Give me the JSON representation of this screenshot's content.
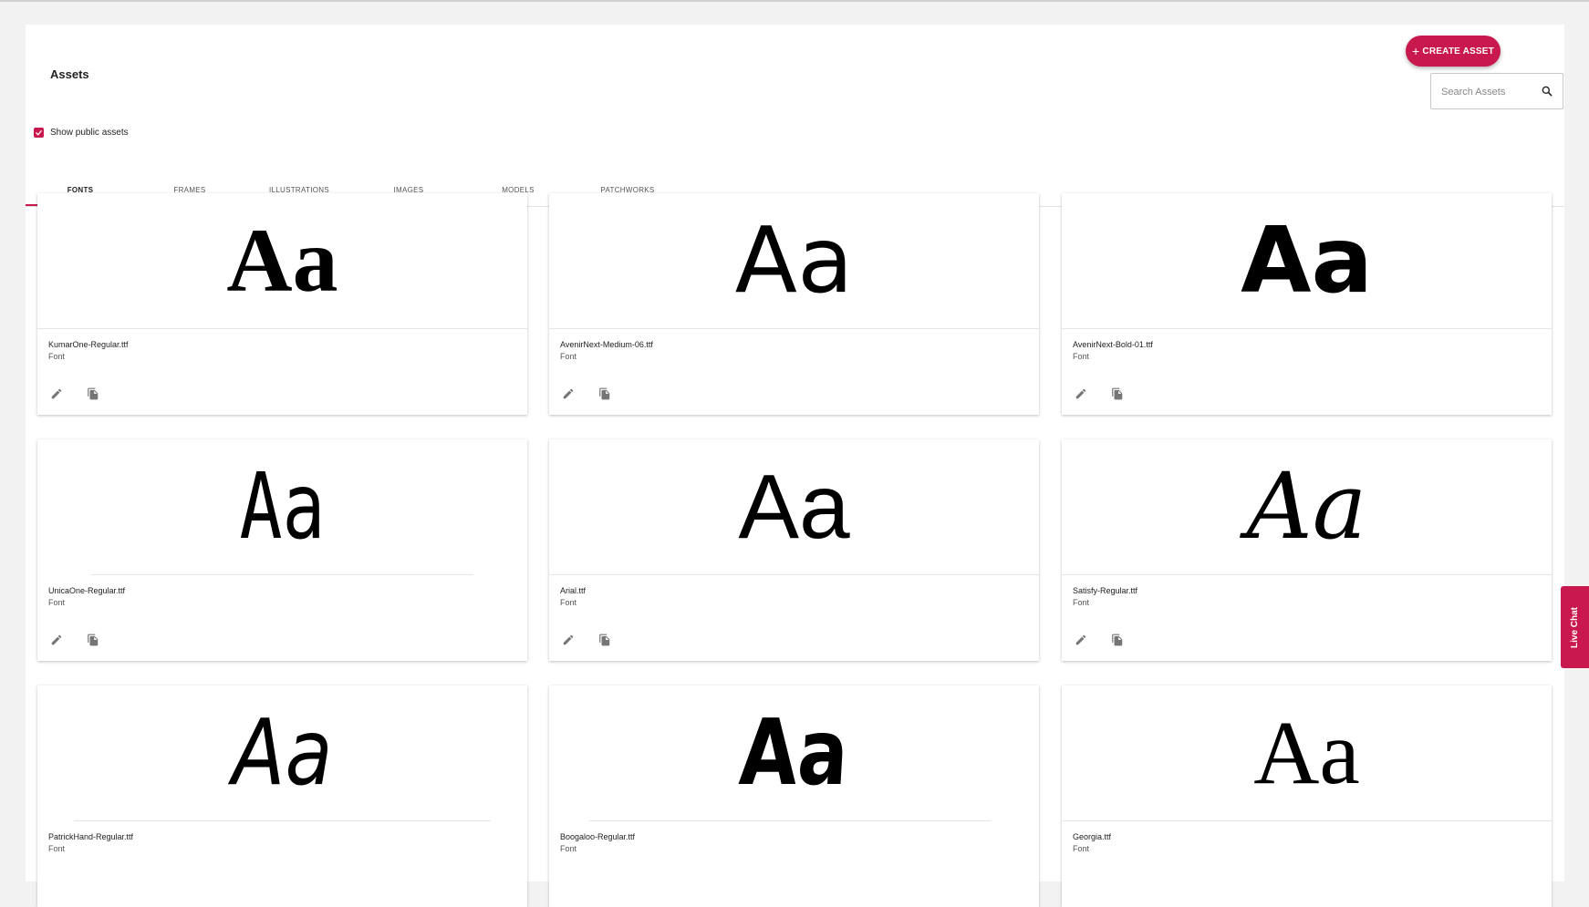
{
  "header": {
    "title": "Assets",
    "create_label": "CREATE ASSET",
    "search_placeholder": "Search Assets",
    "show_public_label": "Show public assets",
    "show_public_checked": true
  },
  "tabs": [
    {
      "label": "FONTS",
      "active": true
    },
    {
      "label": "FRAMES",
      "active": false
    },
    {
      "label": "ILLUSTRATIONS",
      "active": false
    },
    {
      "label": "IMAGES",
      "active": false
    },
    {
      "label": "MODELS",
      "active": false
    },
    {
      "label": "PATCHWORKS",
      "active": false
    }
  ],
  "assets": [
    {
      "preview": "Aa",
      "name": "KumarOne-Regular.ttf",
      "type": "Font"
    },
    {
      "preview": "Aa",
      "name": "AvenirNext-Medium-06.ttf",
      "type": "Font"
    },
    {
      "preview": "Aa",
      "name": "AvenirNext-Bold-01.ttf",
      "type": "Font"
    },
    {
      "preview": "Aa",
      "name": "UnicaOne-Regular.ttf",
      "type": "Font"
    },
    {
      "preview": "Aa",
      "name": "Arial.ttf",
      "type": "Font"
    },
    {
      "preview": "Aa",
      "name": "Satisfy-Regular.ttf",
      "type": "Font"
    },
    {
      "preview": "Aa",
      "name": "PatrickHand-Regular.ttf",
      "type": "Font"
    },
    {
      "preview": "Aa",
      "name": "Boogaloo-Regular.ttf",
      "type": "Font"
    },
    {
      "preview": "Aa",
      "name": "Georgia.ttf",
      "type": "Font"
    }
  ],
  "live_chat_label": "Live Chat",
  "colors": {
    "accent": "#c8184d",
    "icon": "#757575"
  },
  "icons": {
    "search": "search-icon",
    "edit": "pencil-icon",
    "copy": "copy-icon",
    "plus": "plus-icon",
    "check": "check-icon"
  }
}
